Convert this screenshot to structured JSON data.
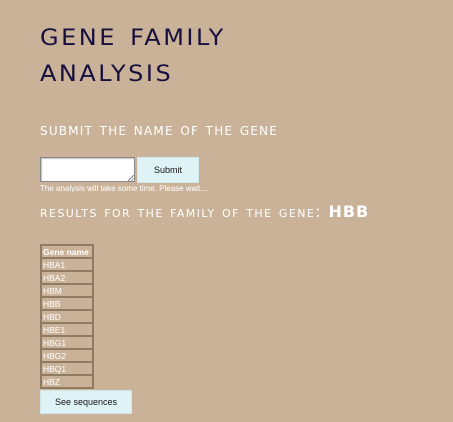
{
  "page": {
    "title_line1": "Gene Family",
    "title_line2": "Analysis",
    "subtitle": "Submit the name of the gene"
  },
  "form": {
    "gene_input_value": "",
    "submit_label": "Submit",
    "wait_note": "The analysis will take some time. Please wait...."
  },
  "results": {
    "heading_prefix": "Results for the family of the gene: ",
    "gene": "HBB",
    "table_header": "Gene name",
    "genes": [
      "HBA1",
      "HBA2",
      "HBM",
      "HBB",
      "HBD",
      "HBE1",
      "HBG1",
      "HBG2",
      "HBQ1",
      "HBZ"
    ],
    "see_sequences_label": "See sequences"
  },
  "colors": {
    "background": "#c9b297",
    "title": "#17103f",
    "button": "#dff3f6"
  }
}
